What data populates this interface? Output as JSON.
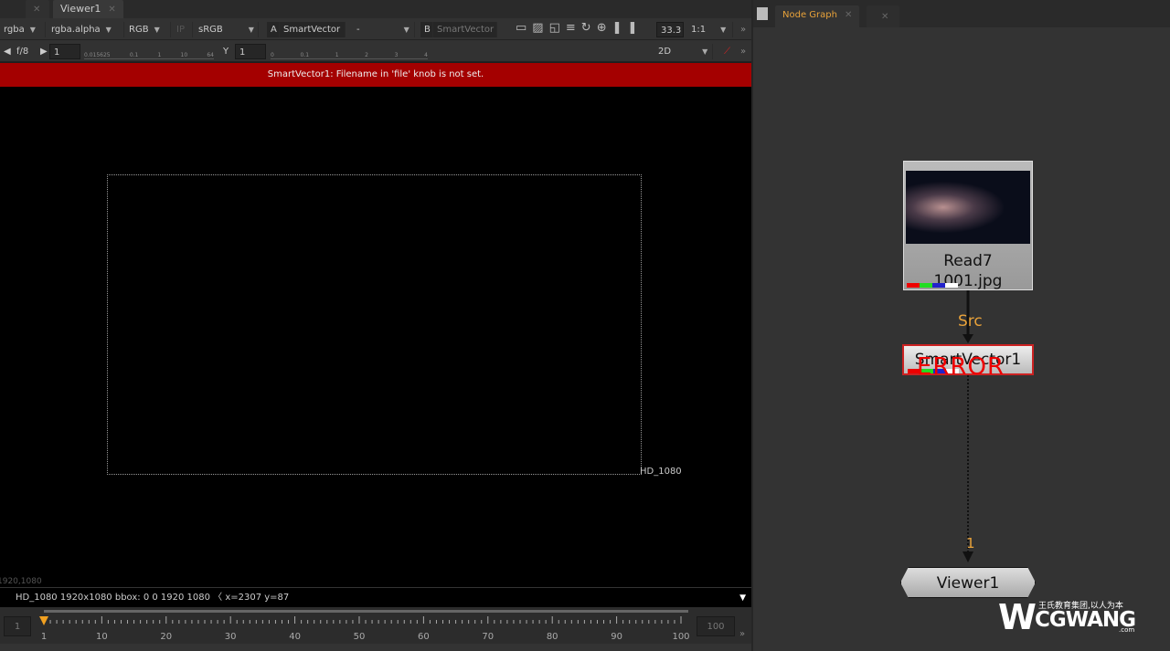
{
  "viewer": {
    "tab": "Viewer1",
    "toolbar1": {
      "channels": "rgba",
      "alpha": "rgba.alpha",
      "display": "RGB",
      "ip": "IP",
      "lut": "sRGB",
      "a_label": "A",
      "a_input": "SmartVector",
      "wipe": "-",
      "b_label": "B",
      "b_input": "SmartVector",
      "zoom": "33.3",
      "ratio": "1:1"
    },
    "toolbar2": {
      "fstop": "f/8",
      "gain": "1",
      "gain_ticks": [
        "0.015625",
        "0.1",
        "1",
        "10",
        "64"
      ],
      "gamma_label": "Y",
      "gamma": "1",
      "gamma_ticks": [
        "0",
        "0.1",
        "1",
        "2",
        "3",
        "4"
      ],
      "mode": "2D"
    },
    "error": "SmartVector1: Filename in 'file' knob is not set.",
    "format_label": "HD_1080",
    "corner_label": "1920,1080",
    "info": "HD_1080 1920x1080  bbox: 0 0 1920 1080 〈  x=2307 y=87",
    "timeline": {
      "current": "1",
      "start": 1,
      "end": 100,
      "end_field": "100",
      "labels": [
        "1",
        "10",
        "20",
        "30",
        "40",
        "50",
        "60",
        "70",
        "80",
        "90",
        "100"
      ]
    }
  },
  "nodegraph": {
    "tab": "Node Graph",
    "nodes": {
      "read_name": "Read7",
      "read_file": "1001.jpg",
      "src_label": "Src",
      "smartvector": "SmartVector1",
      "error": "ERROR",
      "input_label": "1",
      "viewer": "Viewer1"
    },
    "accent": "#e8a23a"
  },
  "watermark": {
    "text": "CGWANG",
    "sub": "王氏教育集团,以人为本",
    ".com": ".com"
  }
}
